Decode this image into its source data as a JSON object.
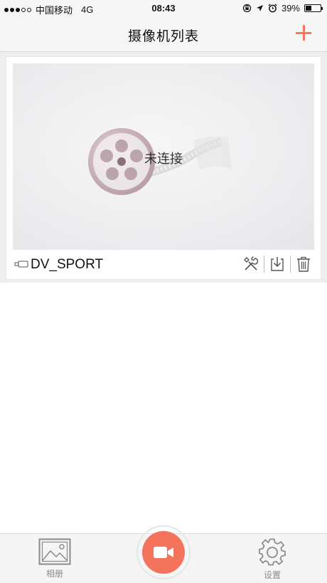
{
  "status_bar": {
    "carrier": "中国移动",
    "network": "4G",
    "time": "08:43",
    "battery": "39%",
    "battery_level": 0.39
  },
  "nav": {
    "title": "摄像机列表",
    "add_icon": "plus-icon"
  },
  "cameras": [
    {
      "name": "DV_SPORT",
      "status": "未连接",
      "actions": [
        "tools-icon",
        "download-icon",
        "trash-icon"
      ]
    }
  ],
  "tabs": {
    "album_label": "相册",
    "settings_label": "设置",
    "record_icon": "video-camera-icon"
  },
  "colors": {
    "accent": "#f3735d",
    "tab_label": "#8a8a8a",
    "list_background": "#eeeeee"
  }
}
